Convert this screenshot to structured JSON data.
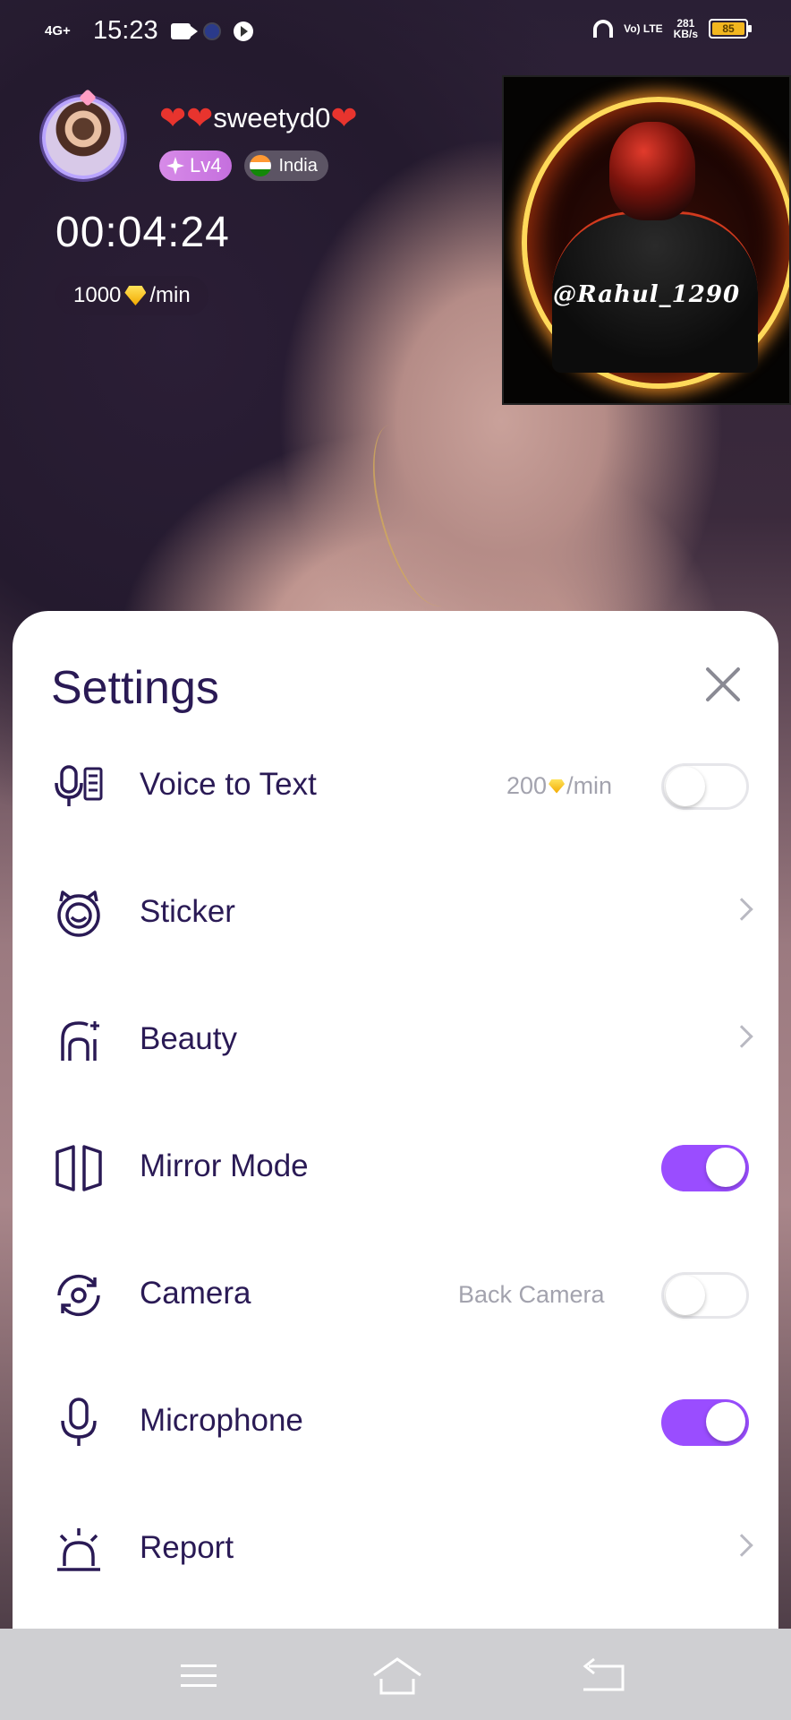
{
  "status_bar": {
    "network": "4G+",
    "time": "15:23",
    "volte": "Vo) LTE",
    "speed_value": "281",
    "speed_unit": "KB/s",
    "battery": "85",
    "colors": {
      "battery_fill": "#f2b61f"
    }
  },
  "call": {
    "caller_name": "sweetyd0",
    "level": "Lv4",
    "country": "India",
    "duration": "00:04:24",
    "rate_amount": "1000",
    "rate_unit": "/min",
    "self_watermark": "@Rahul_1290"
  },
  "settings": {
    "title": "Settings",
    "items": [
      {
        "label": "Voice to Text",
        "hint_amount": "200",
        "hint_unit": "/min",
        "control": "toggle",
        "enabled": false,
        "icon": "mic-text-icon"
      },
      {
        "label": "Sticker",
        "control": "chevron",
        "icon": "face-sticker-icon"
      },
      {
        "label": "Beauty",
        "control": "chevron",
        "icon": "beauty-icon"
      },
      {
        "label": "Mirror Mode",
        "control": "toggle",
        "enabled": true,
        "icon": "mirror-icon"
      },
      {
        "label": "Camera",
        "hint": "Back Camera",
        "control": "toggle",
        "enabled": false,
        "icon": "camera-switch-icon"
      },
      {
        "label": "Microphone",
        "control": "toggle",
        "enabled": true,
        "icon": "microphone-icon"
      },
      {
        "label": "Report",
        "control": "chevron",
        "icon": "alarm-icon"
      }
    ],
    "colors": {
      "accent": "#9a4dff",
      "text": "#2a1a55",
      "hint": "#a3a3ae"
    }
  },
  "nav_bar": {
    "buttons": [
      "menu-icon",
      "home-icon",
      "back-icon"
    ]
  }
}
